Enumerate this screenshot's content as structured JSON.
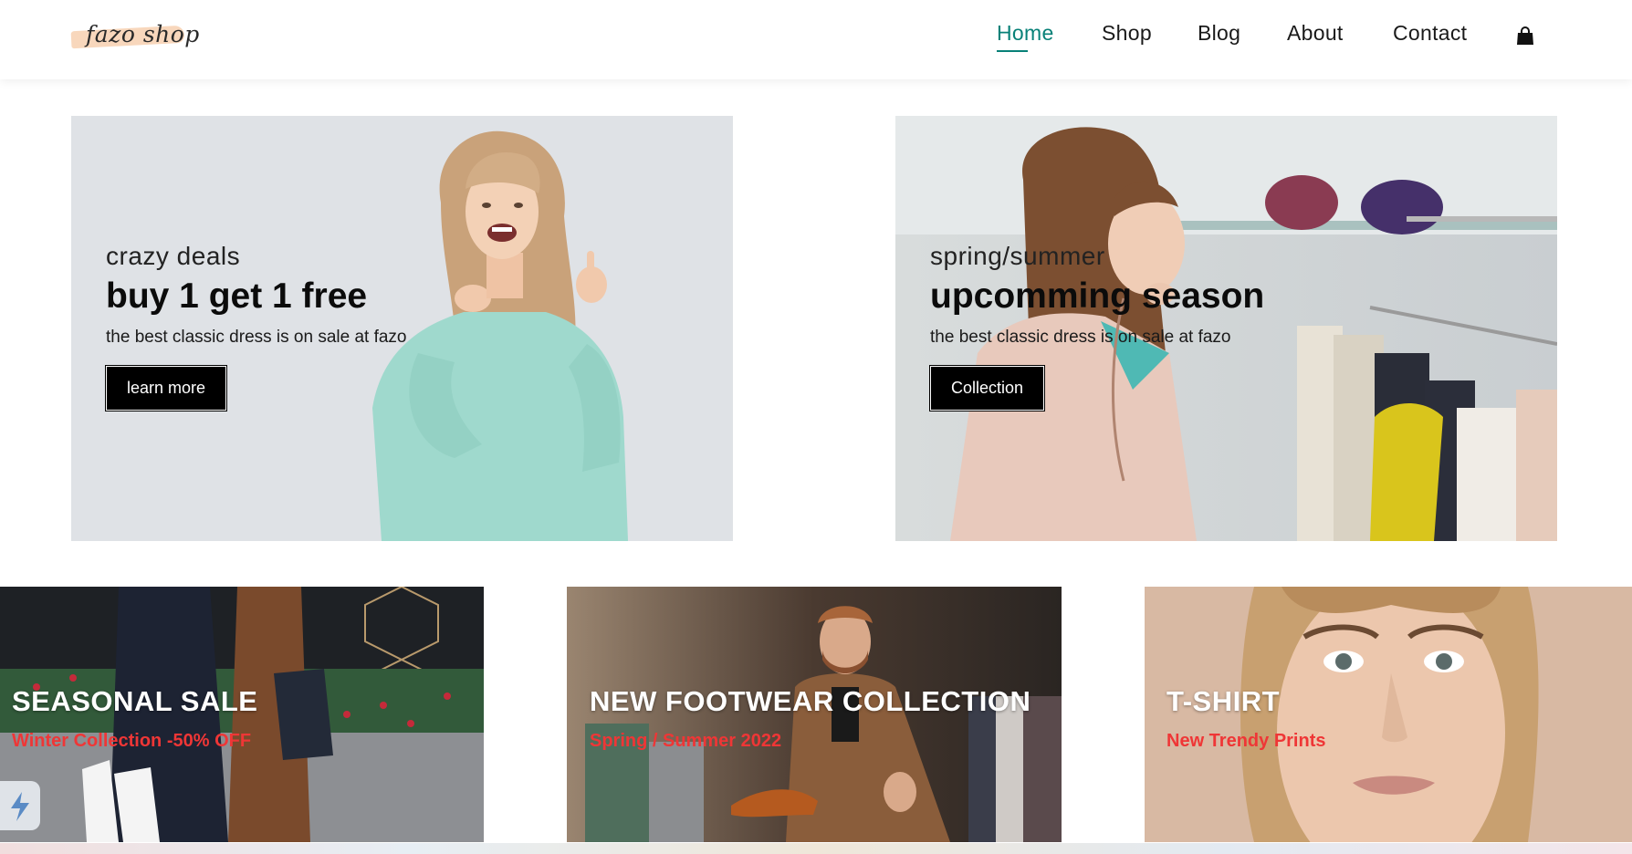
{
  "header": {
    "logo_text": "fazo shop",
    "nav": [
      {
        "label": "Home",
        "active": true
      },
      {
        "label": "Shop",
        "active": false
      },
      {
        "label": "Blog",
        "active": false
      },
      {
        "label": "About",
        "active": false
      },
      {
        "label": "Contact",
        "active": false
      }
    ],
    "cart_icon": "shopping-bag-icon",
    "accent": "#088178"
  },
  "banners": [
    {
      "subtitle": "crazy deals",
      "title": "buy 1 get 1 free",
      "description": "the best classic dress is on sale at fazo",
      "button": "learn more"
    },
    {
      "subtitle": "spring/summer",
      "title": "upcomming season",
      "description": "the best classic dress is on sale at fazo",
      "button": "Collection"
    }
  ],
  "cards": [
    {
      "title": "SEASONAL SALE",
      "subtitle": "Winter Collection -50% OFF"
    },
    {
      "title": "NEW FOOTWEAR COLLECTION",
      "subtitle": "Spring / Summer 2022"
    },
    {
      "title": "T-SHIRT",
      "subtitle": "New Trendy Prints"
    }
  ],
  "colors": {
    "sale_red": "#ef3636",
    "button_black": "#000000"
  }
}
